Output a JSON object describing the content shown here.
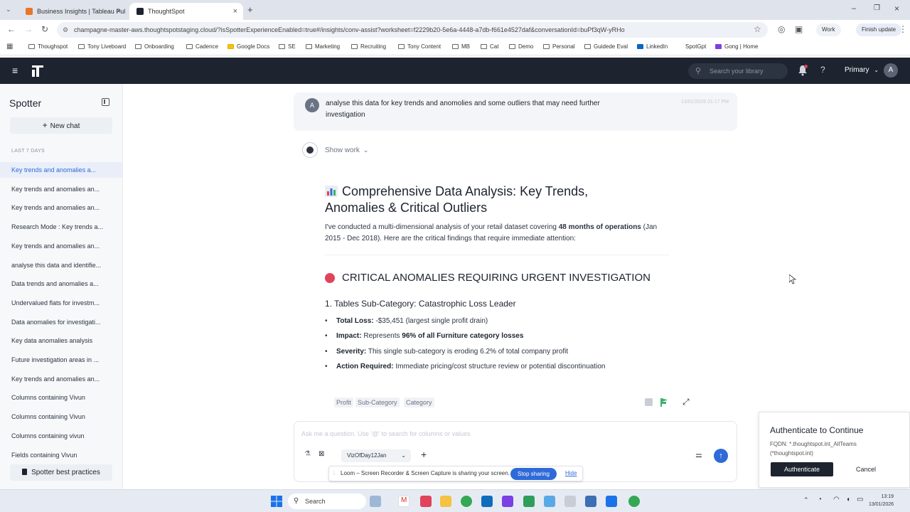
{
  "browser": {
    "tabs": [
      {
        "title": "Business Insights | Tableau Pul",
        "active": false
      },
      {
        "title": "ThoughtSpot",
        "active": true
      }
    ],
    "url": "champagne-master-aws.thoughtspotstaging.cloud/?isSpotterExperienceEnabled=true#/insights/conv-assist?worksheet=f2229b20-5e6a-4448-a7db-f661e4527daf&conversationId=buPf3qW-yRHo",
    "profile_label": "Work",
    "finish_update": "Finish update",
    "bookmarks": [
      "Thoughspot",
      "Tony Liveboard",
      "Onboarding",
      "Cadence",
      "Google Docs",
      "SE",
      "Marketing",
      "Recruiting",
      "Tony Content",
      "MB",
      "Cat",
      "Demo",
      "Personal",
      "Guidede Eval",
      "LinkedIn",
      "SpotGpt",
      "Gong | Home"
    ]
  },
  "app": {
    "search_placeholder": "Search your library",
    "org": "Primary",
    "avatar": "A"
  },
  "sidebar": {
    "title": "Spotter",
    "new_chat": "New chat",
    "section": "LAST 7 DAYS",
    "items": [
      {
        "label": "Key trends and anomalies a...",
        "active": true
      },
      {
        "label": "Key trends and anomalies an...",
        "active": false
      },
      {
        "label": "Key trends and anomalies an...",
        "active": false
      },
      {
        "label": "Research Mode : Key trends a...",
        "active": false
      },
      {
        "label": "Key trends and anomalies an...",
        "active": false
      },
      {
        "label": "analyse this data and identifie...",
        "active": false
      },
      {
        "label": "Data trends and anomalies a...",
        "active": false
      },
      {
        "label": "Undervalued flats for investm...",
        "active": false
      },
      {
        "label": "Data anomalies for investigati...",
        "active": false
      },
      {
        "label": "Key data anomalies analysis",
        "active": false
      },
      {
        "label": "Future investigation areas in ...",
        "active": false
      },
      {
        "label": "Key trends and anomalies an...",
        "active": false
      },
      {
        "label": "Columns containing Vivun",
        "active": false
      },
      {
        "label": "Columns containing Vivun",
        "active": false
      },
      {
        "label": "Columns containing vivun",
        "active": false
      },
      {
        "label": "Fields containing Vivun",
        "active": false
      }
    ],
    "best_practices": "Spotter best practices"
  },
  "conversation": {
    "user_avatar": "A",
    "user_message": "analyse this data for key trends and anomolies and some outliers that may need further investigation",
    "timestamp": "13/01/2026 01:17 PM",
    "show_work": "Show work",
    "heading": "Comprehensive Data Analysis: Key Trends, Anomalies & Critical Outliers",
    "intro_pre": "I've conducted a multi-dimensional analysis of your retail dataset covering ",
    "intro_bold": "48 months of operations",
    "intro_post": " (Jan 2015 - Dec 2018). Here are the critical findings that require immediate attention:",
    "section_title": "CRITICAL ANOMALIES REQUIRING URGENT INVESTIGATION",
    "finding_title": "1. Tables Sub-Category: Catastrophic Loss Leader",
    "bullets": [
      {
        "label": "Total Loss:",
        "text": " -$35,451 (largest single profit drain)"
      },
      {
        "label": "Impact:",
        "text": " Represents ",
        "bold2": "96% of all Furniture category losses"
      },
      {
        "label": "Severity:",
        "text": " This single sub-category is eroding 6.2% of total company profit"
      },
      {
        "label": "Action Required:",
        "text": " Immediate pricing/cost structure review or potential discontinuation"
      }
    ],
    "chips": [
      "Profit",
      "Sub-Category",
      "Category"
    ]
  },
  "input": {
    "placeholder": "Ask me a question. Use '@' to search for columns or values",
    "worksheet": "VizOfDay12Jan"
  },
  "share_bar": {
    "text": "Loom – Screen Recorder & Screen Capture is sharing your screen.",
    "stop": "Stop sharing",
    "hide": "Hide"
  },
  "auth_popup": {
    "title": "Authenticate to Continue",
    "detail": "FQDN: *.thoughtspot.int_AllTeams (*thoughtspot.int)",
    "authenticate": "Authenticate",
    "cancel": "Cancel"
  },
  "taskbar": {
    "search": "Search",
    "time": "13:19",
    "date": "13/01/2026"
  },
  "colors": {
    "app_header": "#1d232f",
    "accent": "#2f6bd8",
    "anomaly_red": "#e0435a"
  }
}
